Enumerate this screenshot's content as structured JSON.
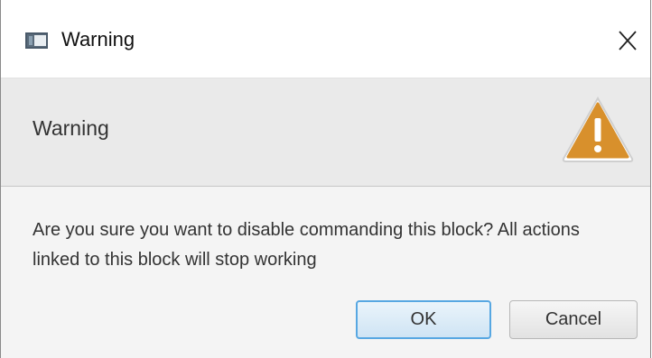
{
  "window": {
    "title": "Warning",
    "app_icon": "window-app-icon",
    "close_icon": "close-icon"
  },
  "header": {
    "text": "Warning",
    "icon": "warning-triangle-icon",
    "icon_color": "#d8902c"
  },
  "content": {
    "message": "Are you sure you want to disable commanding this block? All actions linked to this block will stop working"
  },
  "buttons": {
    "ok_label": "OK",
    "cancel_label": "Cancel",
    "default_button_border": "#57a7e2"
  }
}
